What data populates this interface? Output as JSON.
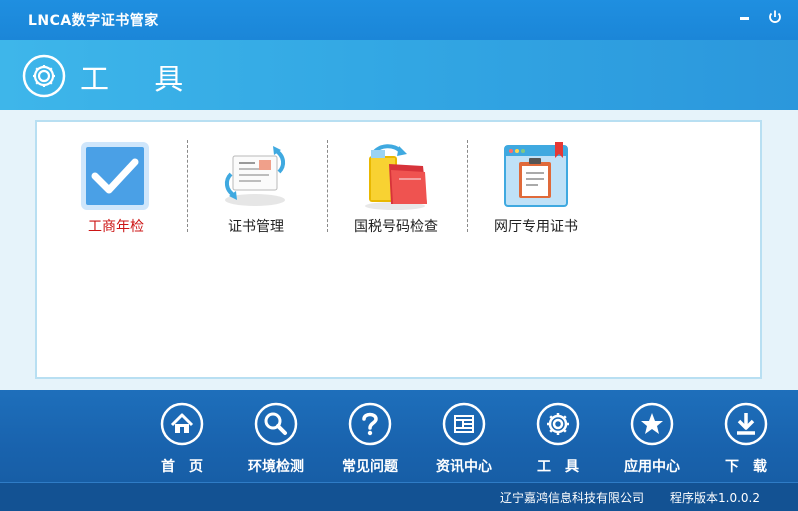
{
  "app": {
    "title": "LNCA数字证书管家"
  },
  "window_controls": {
    "minimize_icon": "minimize-icon",
    "power_icon": "power-icon"
  },
  "header": {
    "title": "工 具",
    "icon": "gear-icon"
  },
  "tools": [
    {
      "label": "工商年检",
      "icon": "checkmark-icon",
      "active": true
    },
    {
      "label": "证书管理",
      "icon": "certificate-sync-icon",
      "active": false
    },
    {
      "label": "国税号码检查",
      "icon": "folder-sync-icon",
      "active": false
    },
    {
      "label": "网厅专用证书",
      "icon": "clipboard-icon",
      "active": false
    }
  ],
  "nav": [
    {
      "label": "首　页",
      "icon": "home-icon"
    },
    {
      "label": "环境检测",
      "icon": "search-icon"
    },
    {
      "label": "常见问题",
      "icon": "question-icon"
    },
    {
      "label": "资讯中心",
      "icon": "news-icon"
    },
    {
      "label": "工　具",
      "icon": "gear-icon"
    },
    {
      "label": "应用中心",
      "icon": "star-icon"
    },
    {
      "label": "下　载",
      "icon": "download-icon"
    }
  ],
  "status": {
    "company": "辽宁嘉鸿信息科技有限公司",
    "version": "程序版本1.0.0.2"
  },
  "colors": {
    "titlebar": "#1b86d8",
    "header": "#33a8e4",
    "nav": "#1963ae",
    "active_label": "#cc1515"
  }
}
